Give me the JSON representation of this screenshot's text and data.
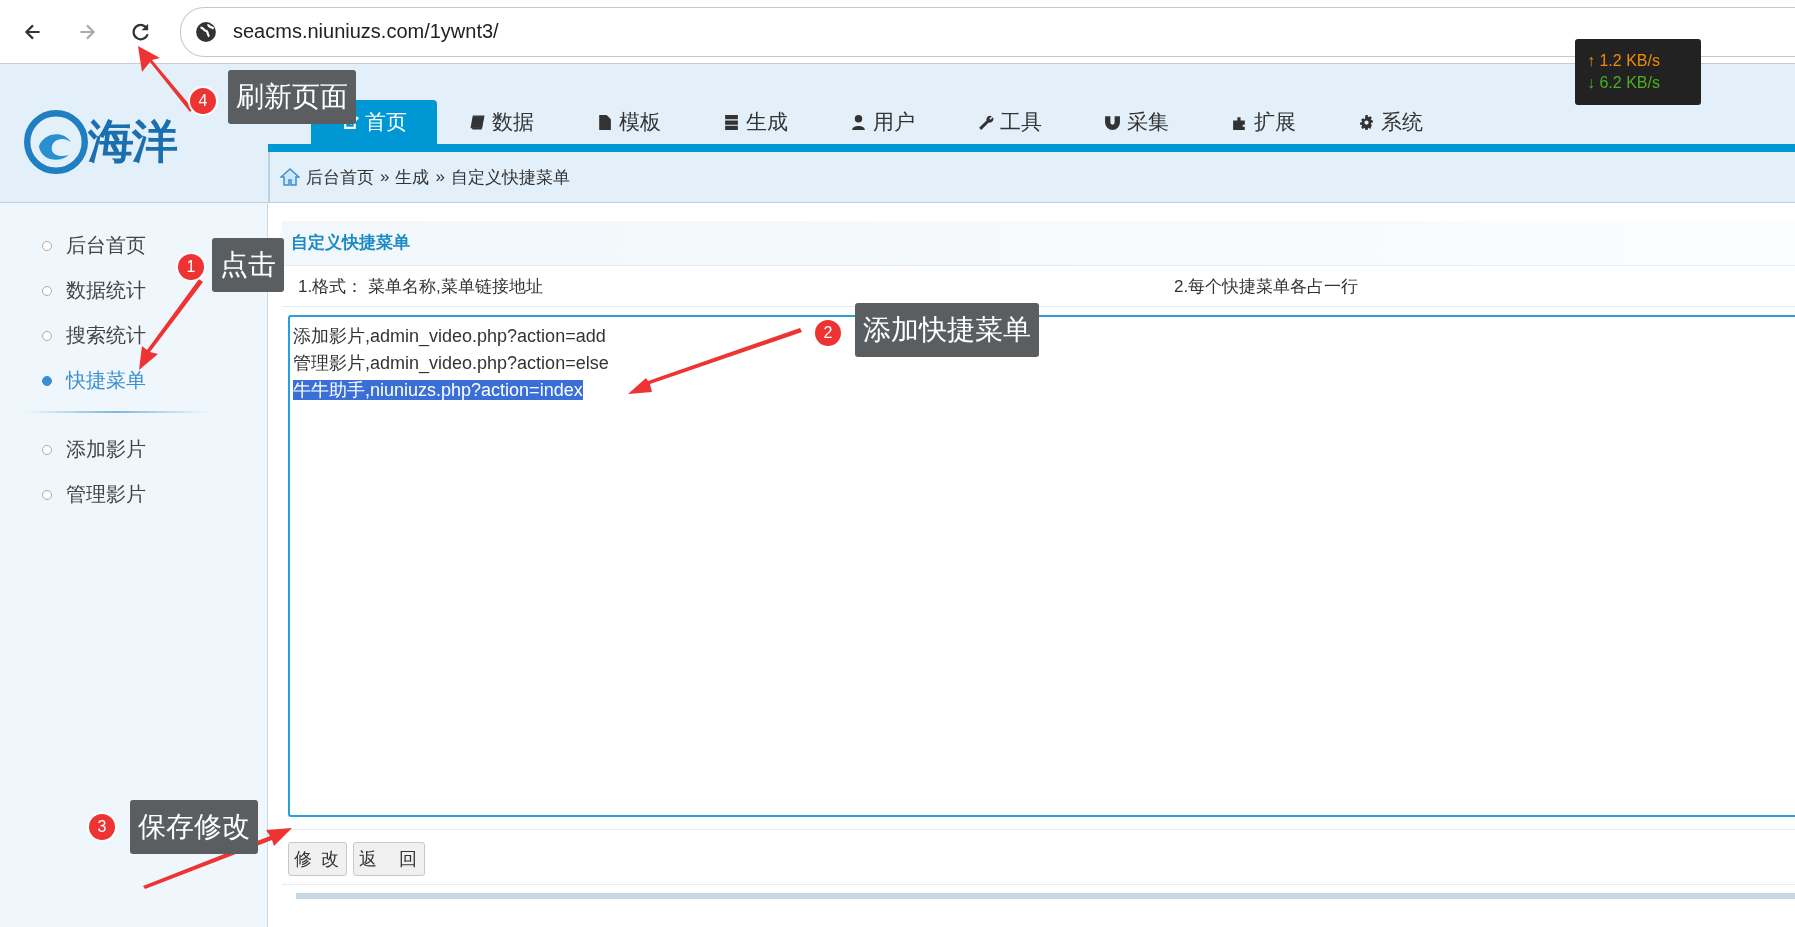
{
  "browser": {
    "url": "seacms.niuniuzs.com/1ywnt3/",
    "forward_disabled": true
  },
  "speed_meter": {
    "upload": "↑ 1.2 KB/s",
    "download": "↓ 6.2 KB/s"
  },
  "logo": {
    "text": "海洋"
  },
  "tabs": [
    {
      "label": "首页",
      "selected": true
    },
    {
      "label": "数据",
      "selected": false
    },
    {
      "label": "模板",
      "selected": false
    },
    {
      "label": "生成",
      "selected": false
    },
    {
      "label": "用户",
      "selected": false
    },
    {
      "label": "工具",
      "selected": false
    },
    {
      "label": "采集",
      "selected": false
    },
    {
      "label": "扩展",
      "selected": false
    },
    {
      "label": "系统",
      "selected": false
    }
  ],
  "breadcrumb": [
    "后台首页",
    "»",
    "生成",
    "»",
    "自定义快捷菜单"
  ],
  "sidebar": {
    "groups": [
      [
        {
          "label": "后台首页",
          "selected": false
        },
        {
          "label": "数据统计",
          "selected": false
        },
        {
          "label": "搜索统计",
          "selected": false
        },
        {
          "label": "快捷菜单",
          "selected": true
        }
      ],
      [
        {
          "label": "添加影片",
          "selected": false
        },
        {
          "label": "管理影片",
          "selected": false
        }
      ]
    ]
  },
  "panel": {
    "title": "自定义快捷菜单",
    "hints": [
      "1.格式： 菜单名称,菜单链接地址",
      "2.每个快捷菜单各占一行"
    ],
    "lines": [
      {
        "text": "添加影片,admin_video.php?action=add",
        "selected": false
      },
      {
        "text": "管理影片,admin_video.php?action=else",
        "selected": false
      },
      {
        "text": "牛牛助手,niuniuzs.php?action=index",
        "selected": true
      }
    ],
    "buttons": [
      "修 改",
      "返　回"
    ]
  },
  "annotations": [
    {
      "number": "4",
      "label": "刷新页面"
    },
    {
      "number": "1",
      "label": "点击"
    },
    {
      "number": "2",
      "label": "添加快捷菜单"
    },
    {
      "number": "3",
      "label": "保存修改"
    }
  ]
}
